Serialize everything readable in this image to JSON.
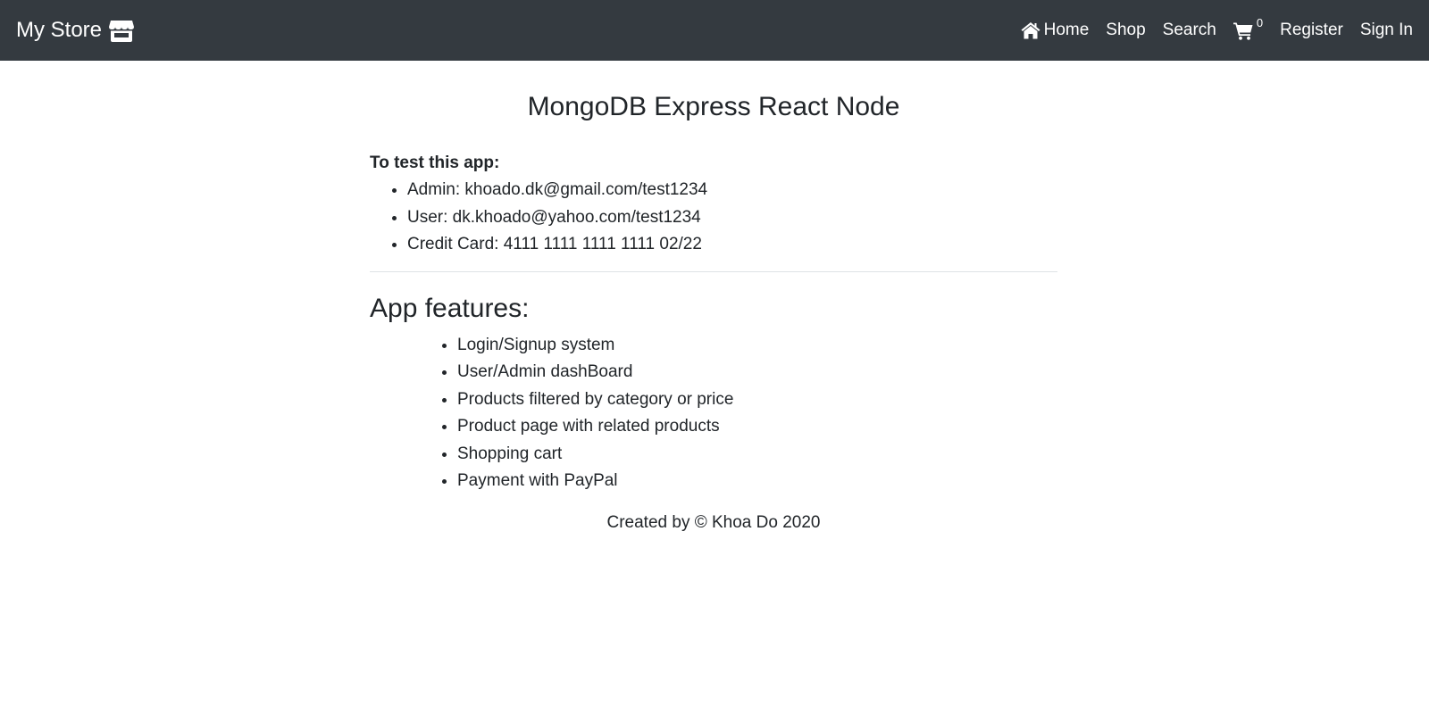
{
  "navbar": {
    "brand_label": "My Store",
    "brand_icon": "store-icon",
    "links": {
      "home": "Home",
      "shop": "Shop",
      "search": "Search",
      "cart_count": "0",
      "register": "Register",
      "sign_in": "Sign In"
    },
    "colors": {
      "background": "#343a40",
      "text": "#ffffff"
    }
  },
  "main": {
    "title": "MongoDB Express React Node",
    "test_heading": "To test this app:",
    "test_items": [
      "Admin: khoado.dk@gmail.com/test1234",
      "User: dk.khoado@yahoo.com/test1234",
      "Credit Card: 4111 1111 1111 1111 02/22"
    ],
    "features_heading": "App features:",
    "features": [
      "Login/Signup system",
      "User/Admin dashBoard",
      "Products filtered by category or price",
      "Product page with related products",
      "Shopping cart",
      "Payment with PayPal"
    ]
  },
  "footer": {
    "text": "Created by © Khoa Do 2020"
  }
}
